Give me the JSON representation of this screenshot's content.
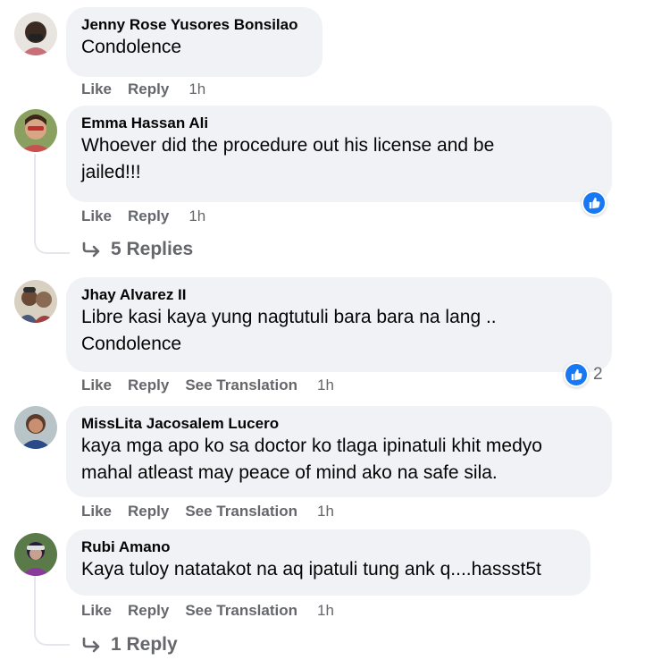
{
  "comments": [
    {
      "author": "Jenny Rose Yusores Bonsilao",
      "lines": [
        "Condolence"
      ],
      "actions": {
        "like": "Like",
        "reply": "Reply",
        "time": "1h"
      }
    },
    {
      "author": "Emma Hassan Ali",
      "lines": [
        "Whoever did the procedure out his license and be",
        "jailed!!!"
      ],
      "actions": {
        "like": "Like",
        "reply": "Reply",
        "time": "1h"
      },
      "replies": "5 Replies"
    },
    {
      "author": "Jhay Alvarez II",
      "lines": [
        "Libre kasi kaya yung nagtutuli bara bara na lang ..",
        "Condolence"
      ],
      "actions": {
        "like": "Like",
        "reply": "Reply",
        "translate": "See Translation",
        "time": "1h"
      },
      "reaction_count": "2"
    },
    {
      "author": "MissLita Jacosalem Lucero",
      "lines": [
        "kaya mga apo ko sa doctor ko tlaga ipinatuli khit medyo",
        "mahal atleast may peace of mind ako na safe sila."
      ],
      "actions": {
        "like": "Like",
        "reply": "Reply",
        "translate": "See Translation",
        "time": "1h"
      }
    },
    {
      "author": "Rubi Amano",
      "lines": [
        "Kaya tuloy natatakot na aq ipatuli tung ank q....hassst5t"
      ],
      "actions": {
        "like": "Like",
        "reply": "Reply",
        "translate": "See Translation",
        "time": "1h"
      },
      "replies": "1 Reply"
    }
  ],
  "colors": {
    "like_blue": "#1877f2",
    "bubble": "#f0f2f5",
    "muted": "#65676b"
  }
}
